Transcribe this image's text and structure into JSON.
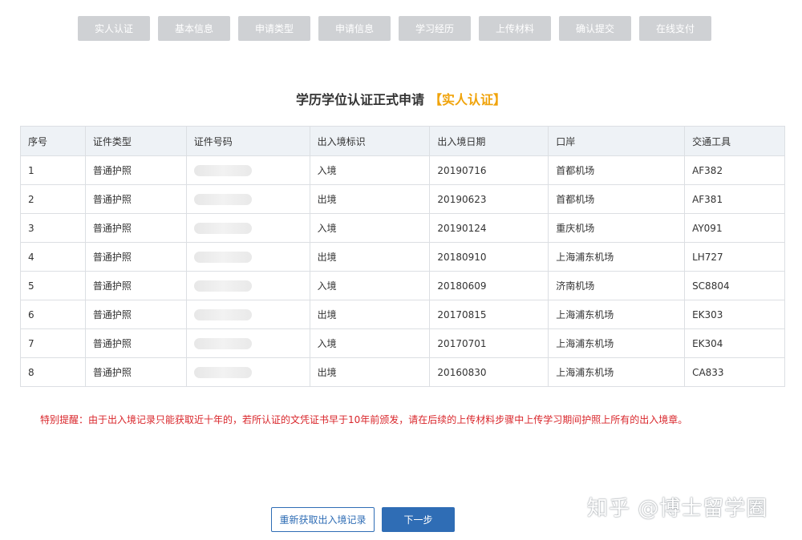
{
  "steps": [
    {
      "label": "实人认证"
    },
    {
      "label": "基本信息"
    },
    {
      "label": "申请类型"
    },
    {
      "label": "申请信息"
    },
    {
      "label": "学习经历"
    },
    {
      "label": "上传材料"
    },
    {
      "label": "确认提交"
    },
    {
      "label": "在线支付"
    }
  ],
  "title": {
    "main": "学历学位认证正式申请",
    "highlight": "【实人认证】"
  },
  "table": {
    "headers": [
      "序号",
      "证件类型",
      "证件号码",
      "出入境标识",
      "出入境日期",
      "口岸",
      "交通工具"
    ],
    "rows": [
      {
        "no": "1",
        "doc_type": "普通护照",
        "direction": "入境",
        "date": "20190716",
        "port": "首都机场",
        "transport": "AF382"
      },
      {
        "no": "2",
        "doc_type": "普通护照",
        "direction": "出境",
        "date": "20190623",
        "port": "首都机场",
        "transport": "AF381"
      },
      {
        "no": "3",
        "doc_type": "普通护照",
        "direction": "入境",
        "date": "20190124",
        "port": "重庆机场",
        "transport": "AY091"
      },
      {
        "no": "4",
        "doc_type": "普通护照",
        "direction": "出境",
        "date": "20180910",
        "port": "上海浦东机场",
        "transport": "LH727"
      },
      {
        "no": "5",
        "doc_type": "普通护照",
        "direction": "入境",
        "date": "20180609",
        "port": "济南机场",
        "transport": "SC8804"
      },
      {
        "no": "6",
        "doc_type": "普通护照",
        "direction": "出境",
        "date": "20170815",
        "port": "上海浦东机场",
        "transport": "EK303"
      },
      {
        "no": "7",
        "doc_type": "普通护照",
        "direction": "入境",
        "date": "20170701",
        "port": "上海浦东机场",
        "transport": "EK304"
      },
      {
        "no": "8",
        "doc_type": "普通护照",
        "direction": "出境",
        "date": "20160830",
        "port": "上海浦东机场",
        "transport": "CA833"
      }
    ]
  },
  "notice": "特别提醒：由于出入境记录只能获取近十年的，若所认证的文凭证书早于10年前颁发，请在后续的上传材料步骤中上传学习期间护照上所有的出入境章。",
  "buttons": {
    "refetch": "重新获取出入境记录",
    "next": "下一步"
  },
  "watermark": "知乎 @博士留学圈",
  "colors": {
    "step_bg": "#cfd1d4",
    "title_highlight": "#f0a30a",
    "notice": "#d9262b",
    "primary": "#2f6db5",
    "header_bg": "#eef2f6"
  }
}
